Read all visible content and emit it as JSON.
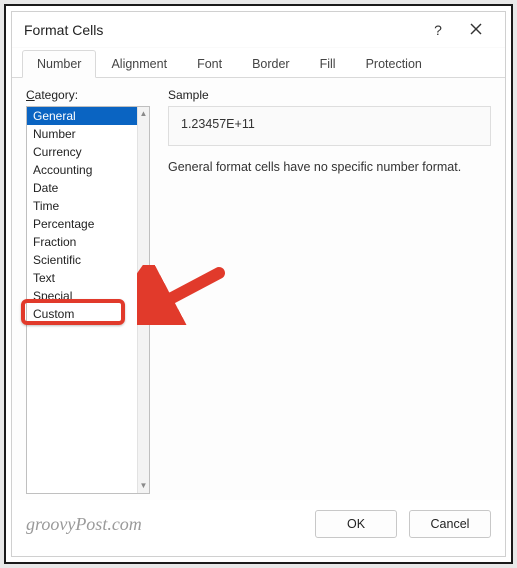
{
  "dialog": {
    "title": "Format Cells"
  },
  "tabs": [
    {
      "label": "Number",
      "active": true
    },
    {
      "label": "Alignment",
      "active": false
    },
    {
      "label": "Font",
      "active": false
    },
    {
      "label": "Border",
      "active": false
    },
    {
      "label": "Fill",
      "active": false
    },
    {
      "label": "Protection",
      "active": false
    }
  ],
  "category": {
    "label_prefix": "C",
    "label_rest": "ategory:",
    "items": [
      {
        "label": "General",
        "selected": true
      },
      {
        "label": "Number",
        "selected": false
      },
      {
        "label": "Currency",
        "selected": false
      },
      {
        "label": "Accounting",
        "selected": false
      },
      {
        "label": "Date",
        "selected": false
      },
      {
        "label": "Time",
        "selected": false
      },
      {
        "label": "Percentage",
        "selected": false
      },
      {
        "label": "Fraction",
        "selected": false
      },
      {
        "label": "Scientific",
        "selected": false
      },
      {
        "label": "Text",
        "selected": false
      },
      {
        "label": "Special",
        "selected": false
      },
      {
        "label": "Custom",
        "selected": false
      }
    ]
  },
  "sample": {
    "label": "Sample",
    "value": "1.23457E+11"
  },
  "description": "General format cells have no specific number format.",
  "buttons": {
    "ok": "OK",
    "cancel": "Cancel"
  },
  "watermark": "groovyPost.com",
  "annotation": {
    "highlight_item": "Custom",
    "arrow_color": "#e13a2b"
  }
}
